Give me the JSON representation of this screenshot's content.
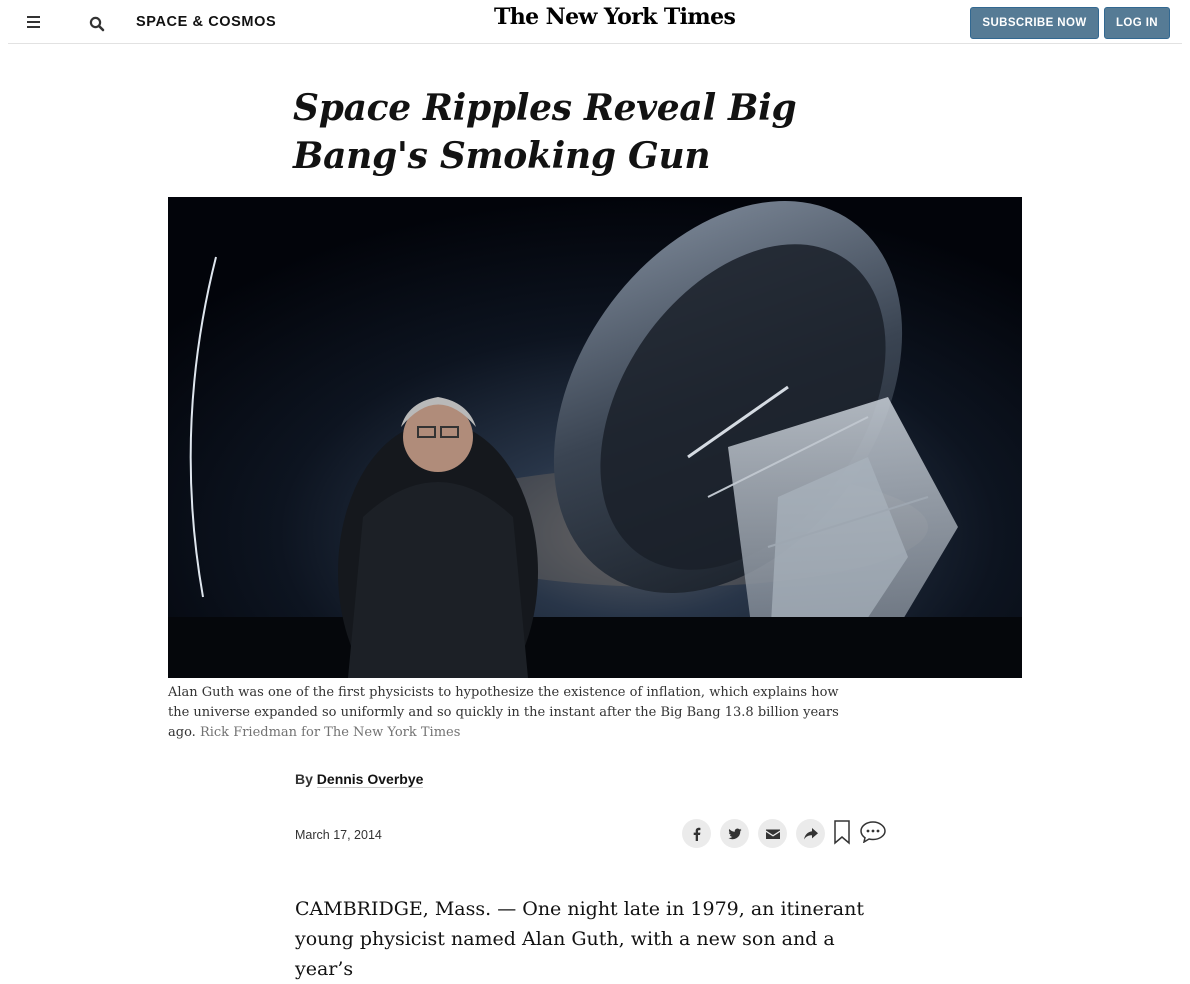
{
  "header": {
    "section": "SPACE & COSMOS",
    "logo_text": "The New York Times",
    "subscribe_label": "SUBSCRIBE NOW",
    "login_label": "LOG IN",
    "icons": [
      "menu-icon",
      "search-icon"
    ]
  },
  "article": {
    "headline": "Space Ripples Reveal Big Bang's Smoking Gun",
    "caption": "Alan Guth was one of the first physicists to hypothesize the existence of inflation, which explains how the universe expanded so uniformly and so quickly in the instant after the Big Bang 13.8 billion years ago.",
    "credit": "Rick Friedman for The New York Times",
    "byline_prefix": "By",
    "author": "Dennis Overbye",
    "date": "March 17, 2014",
    "body_start": "CAMBRIDGE, Mass. — One night late in 1979, an itinerant young physicist named Alan Guth, with a new son and a year’s"
  },
  "share": {
    "icons": [
      "facebook-icon",
      "twitter-icon",
      "email-icon",
      "share-icon",
      "bookmark-icon",
      "comments-icon"
    ]
  },
  "colors": {
    "button_bg": "#567b95",
    "text": "#121212",
    "caption_credit": "#727272"
  }
}
